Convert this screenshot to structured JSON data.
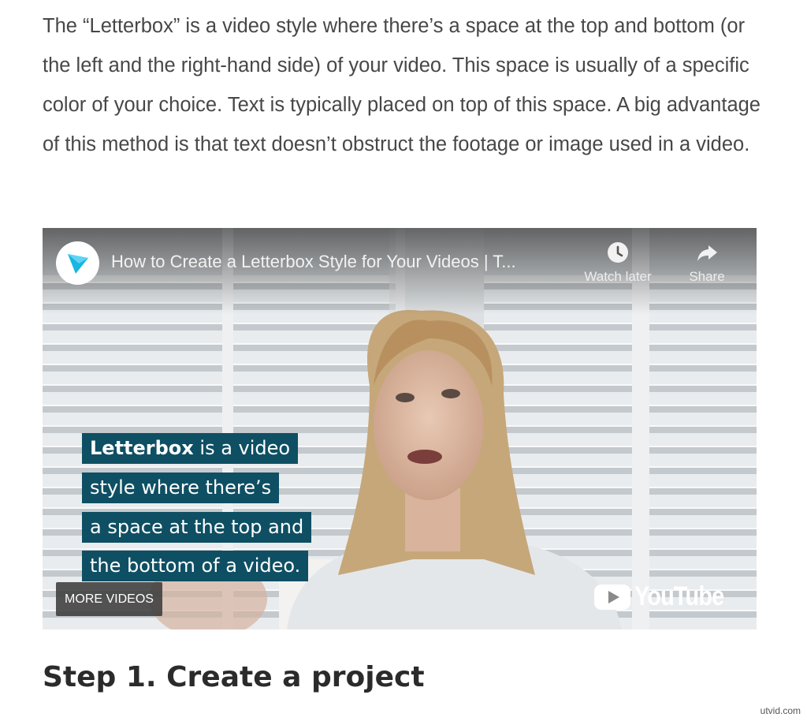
{
  "article": {
    "paragraph": "The “Letterbox” is a video style where there’s a space at the top and bottom (or the left and the right-hand side) of your video. This space is usually of a specific color of your choice. Text is typically placed on top of this space. A big advantage of this method is that text doesn’t obstruct the footage or image used in a video.",
    "step_heading": "Step 1. Create a project"
  },
  "video": {
    "title": "How to Create a Letterbox Style for Your Videos | T...",
    "channel_icon": "play-logo-icon",
    "watch_later_label": "Watch later",
    "watch_later_icon": "clock-icon",
    "share_label": "Share",
    "share_icon": "share-arrow-icon",
    "more_videos_label": "MORE VIDEOS",
    "youtube_word": "YouTube",
    "youtube_icon": "youtube-play-icon",
    "caption_lines": [
      {
        "bold": "Letterbox",
        "rest": " is a video"
      },
      {
        "bold": "",
        "rest": "style where there’s"
      },
      {
        "bold": "",
        "rest": "a space at the top and"
      },
      {
        "bold": "",
        "rest": "the bottom of a video."
      }
    ],
    "caption_color": "#0e4f63"
  },
  "watermark": "utvid.com"
}
